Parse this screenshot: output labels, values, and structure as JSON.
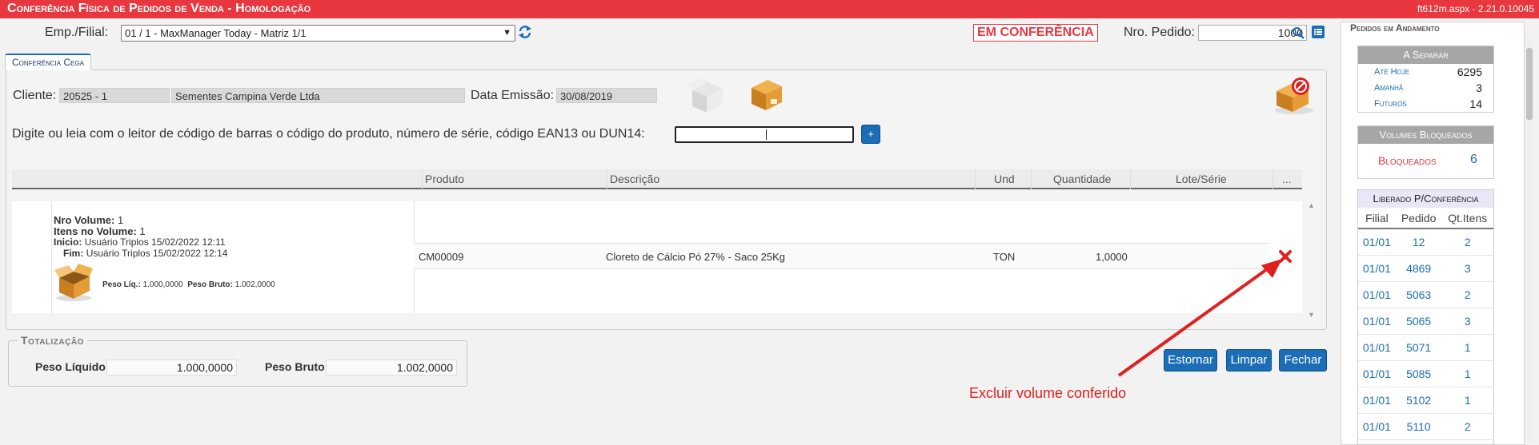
{
  "titlebar": {
    "title": "Conferência Física de Pedidos de Venda  - Homologação",
    "version": "ft612m.aspx - 2.21.0.10045"
  },
  "toolbar": {
    "emp_label": "Emp./Filial:",
    "emp_value": "01 / 1 - MaxManager Today - Matriz 1/1",
    "status_badge": "EM CONFERÊNCIA",
    "pedido_label": "Nro. Pedido:",
    "pedido_value": "1000"
  },
  "tab": {
    "label": "Conferência Cega"
  },
  "header": {
    "cliente_label": "Cliente:",
    "cliente_code": "20525 - 1",
    "cliente_name": "Sementes Campina Verde Ltda",
    "data_label": "Data Emissão:",
    "data_value": "30/08/2019"
  },
  "barcode": {
    "prompt": "Digite ou leia com o leitor de código de barras o código do produto, número de série, código EAN13 ou DUN14:",
    "value": "",
    "add_label": "+"
  },
  "grid": {
    "columns": [
      "Produto",
      "Descrição",
      "Und",
      "Quantidade",
      "Lote/Série",
      "..."
    ],
    "volume": {
      "nro_label": "Nro Volume:",
      "nro_value": "1",
      "itens_label": "Itens no Volume:",
      "itens_value": "1",
      "inicio_label": "Inicio:",
      "inicio_value": "Usuário Triplos 15/02/2022 12:11",
      "fim_label": "Fim:",
      "fim_value": "Usuário Triplos 15/02/2022 12:14",
      "peso_liq_label": "Peso Líq.:",
      "peso_liq_value": "1.000,0000",
      "peso_bruto_label": "Peso Bruto:",
      "peso_bruto_value": "1.002,0000"
    },
    "rows": [
      {
        "produto": "CM00009",
        "descricao": "Cloreto de Cálcio Pó 27% - Saco 25Kg",
        "und": "TON",
        "quantidade": "1,0000",
        "lote": ""
      }
    ]
  },
  "annotation": {
    "text": "Excluir volume conferido",
    "color": "#e0201e"
  },
  "totalizacao": {
    "legend": "Totalização",
    "peso_liquido_label": "Peso Líquido:",
    "peso_liquido_value": "1.000,0000",
    "peso_bruto_label": "Peso Bruto:",
    "peso_bruto_value": "1.002,0000"
  },
  "buttons": {
    "estornar": "Estornar",
    "limpar": "Limpar",
    "fechar": "Fechar"
  },
  "sidebar": {
    "title": "Pedidos em Andamento",
    "a_separar": {
      "title": "A Separar",
      "items": [
        {
          "label": "Até Hoje",
          "value": "6295"
        },
        {
          "label": "Amanhã",
          "value": "3"
        },
        {
          "label": "Futuros",
          "value": "14"
        }
      ]
    },
    "bloqueados": {
      "title": "Volumes Bloqueados",
      "label": "Bloqueados",
      "value": "6"
    },
    "liberado": {
      "title": "Liberado P/Conferência",
      "columns": [
        "Filial",
        "Pedido",
        "Qt.Itens"
      ],
      "rows": [
        [
          "01/01",
          "12",
          "2"
        ],
        [
          "01/01",
          "4869",
          "3"
        ],
        [
          "01/01",
          "5063",
          "2"
        ],
        [
          "01/01",
          "5065",
          "3"
        ],
        [
          "01/01",
          "5071",
          "1"
        ],
        [
          "01/01",
          "5085",
          "1"
        ],
        [
          "01/01",
          "5102",
          "1"
        ],
        [
          "01/01",
          "5110",
          "2"
        ]
      ]
    }
  },
  "colors": {
    "brand_red": "#e8373f",
    "accent_blue": "#1b6db5"
  }
}
